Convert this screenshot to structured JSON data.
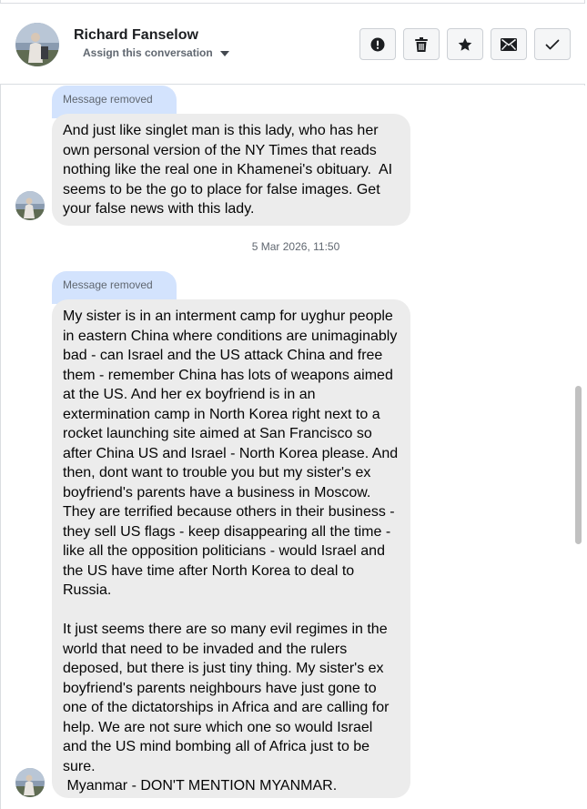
{
  "header": {
    "contact_name": "Richard Fanselow",
    "assign_label": "Assign this conversation",
    "actions": [
      {
        "icon": "exclamation-icon"
      },
      {
        "icon": "trash-icon"
      },
      {
        "icon": "star-icon"
      },
      {
        "icon": "envelope-icon"
      },
      {
        "icon": "checkmark-icon"
      }
    ]
  },
  "messages": [
    {
      "removed_label": "Message removed",
      "text": "And just like singlet man is this lady, who has her own personal version of the NY Times that reads nothing like the real one in Khamenei's obituary.  AI seems to be the go to place for false images. Get your false news with this lady."
    },
    {
      "removed_label": "Message removed",
      "text": "My sister is in an interment camp for uyghur people in eastern China where conditions are unimaginably bad - can Israel and the US attack China and free them - remember China has lots of weapons aimed at the US. And her ex boyfriend is in an extermination camp in North Korea right next to a rocket launching site aimed at San Francisco so after China US and Israel - North Korea please. And then, dont want to trouble you but my sister's ex boyfriend's parents have a business in Moscow. They are terrified because others in their business - they sell US flags - keep disappearing all the time - like all the opposition politicians - would Israel and the US have time after North Korea to deal to Russia.\n\nIt just seems there are so many evil regimes in the world that need to be invaded and the rulers deposed, but there is just tiny thing. My sister's ex boyfriend's parents neighbours have just gone to one of the dictatorships in Africa and are calling for help. We are not sure which one so would Israel and the US mind bombing all of Africa just to be sure.\n Myanmar - DON'T MENTION MYANMAR."
    }
  ],
  "timestamp": "5 Mar 2026, 11:50",
  "colors": {
    "bubble_bg": "#ececec",
    "removed_tab_bg": "#d3e3fd",
    "border": "#dadde1",
    "text": "#1c1e21",
    "muted": "#606770"
  }
}
